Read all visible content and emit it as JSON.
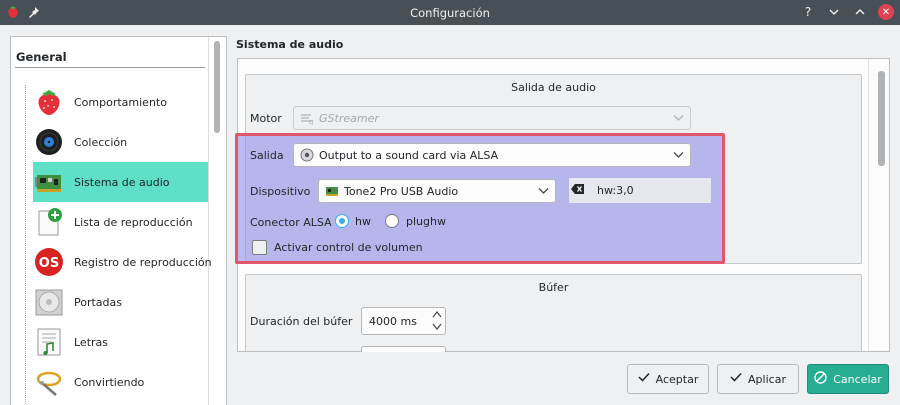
{
  "window": {
    "title": "Configuración"
  },
  "sidebar": {
    "header": "General",
    "items": [
      {
        "label": "Comportamiento",
        "icon": "strawberry-icon"
      },
      {
        "label": "Colección",
        "icon": "vinyl-record-icon"
      },
      {
        "label": "Sistema de audio",
        "icon": "sound-card-icon",
        "selected": true
      },
      {
        "label": "Lista de reproducción",
        "icon": "playlist-add-icon"
      },
      {
        "label": "Registro de reproducción",
        "icon": "lastfm-icon"
      },
      {
        "label": "Portadas",
        "icon": "cd-cover-icon"
      },
      {
        "label": "Letras",
        "icon": "lyrics-icon"
      },
      {
        "label": "Convirtiendo",
        "icon": "transcode-icon"
      }
    ]
  },
  "page": {
    "title": "Sistema de audio",
    "output_group": {
      "title": "Salida de audio",
      "motor_label": "Motor",
      "motor_value": "GStreamer",
      "salida_label": "Salida",
      "salida_value": "Output to a sound card via ALSA",
      "dispositivo_label": "Dispositivo",
      "dispositivo_value": "Tone2 Pro USB Audio",
      "device_id": "hw:3,0",
      "conector_label": "Conector ALSA",
      "radio_hw": "hw",
      "radio_plughw": "plughw",
      "volume_label": "Activar control de volumen"
    },
    "buffer_group": {
      "title": "Búfer",
      "duration_label": "Duración del búfer",
      "duration_value": "4000 ms"
    }
  },
  "buttons": {
    "accept": "Aceptar",
    "apply": "Aplicar",
    "cancel": "Cancelar"
  },
  "colors": {
    "titlebar": "#475057",
    "selection": "#5ee0c8",
    "highlight": "#9696eb",
    "highlight_border": "#e2566a",
    "primary_button": "#27ae92",
    "close_button": "#da4453"
  }
}
